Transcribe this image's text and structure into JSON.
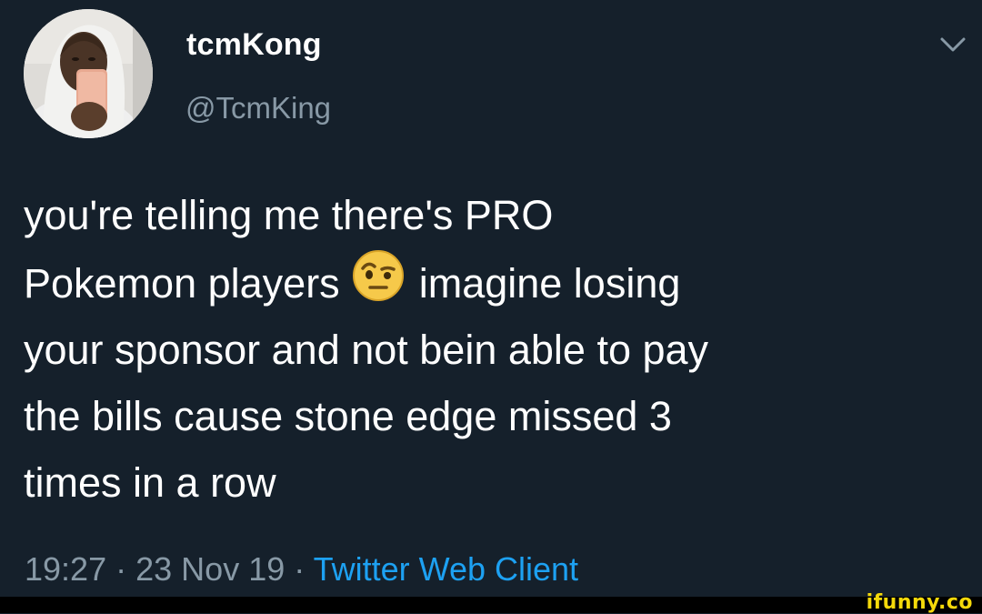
{
  "user": {
    "display_name": "tcmKong",
    "handle": "@TcmKing",
    "avatar_icon": "avatar-selfie-photo"
  },
  "menu_icon": "chevron-down-icon",
  "tweet": {
    "lines": [
      "you're telling me there's PRO",
      "Pokemon players",
      "imagine losing",
      "your sponsor and not bein able to pay",
      "the bills cause stone edge missed 3",
      "times in a row"
    ],
    "emoji": "face-with-raised-eyebrow-emoji"
  },
  "meta": {
    "time": "19:27",
    "separator": "·",
    "date": "23 Nov 19",
    "client": "Twitter Web Client"
  },
  "watermark": "ifunny.co",
  "colors": {
    "background": "#15202b",
    "text": "#ffffff",
    "secondary_text": "#8899a6",
    "link": "#1da1f2",
    "watermark": "#f5d90a"
  }
}
